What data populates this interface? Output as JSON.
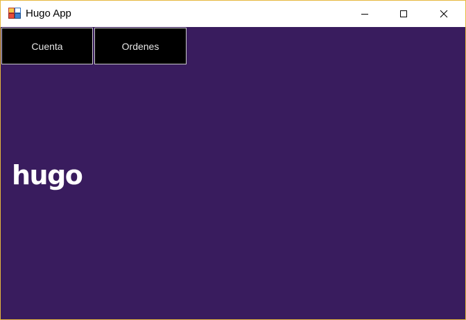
{
  "window": {
    "title": "Hugo App",
    "icon": "app-window-icon",
    "controls": [
      "minimize-icon",
      "maximize-icon",
      "close-icon"
    ]
  },
  "nav": {
    "cuenta_label": "Cuenta",
    "ordenes_label": "Ordenes"
  },
  "logo": {
    "text": "hugo",
    "color": "#ffffff"
  },
  "colors": {
    "background": "#391c5e",
    "button_bg": "#000000",
    "button_text": "#e6e6e6",
    "window_border": "#e6b73c"
  }
}
